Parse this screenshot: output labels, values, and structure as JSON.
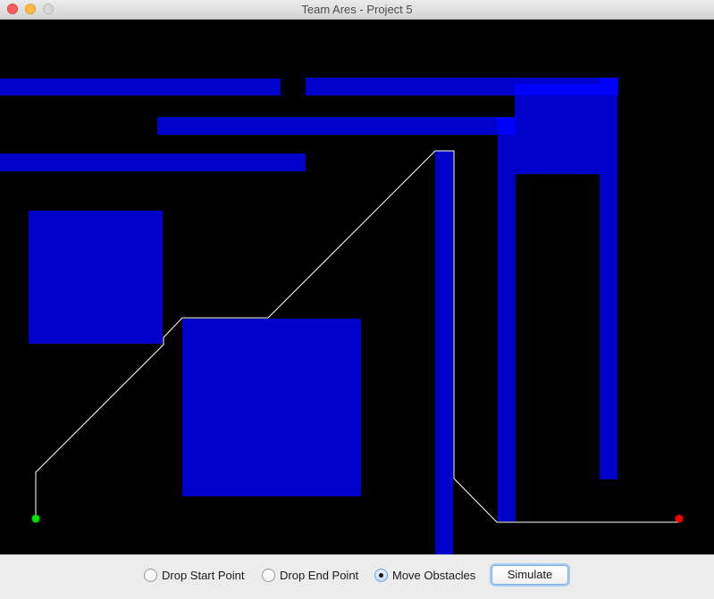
{
  "window": {
    "title": "Team Ares - Project 5"
  },
  "canvas": {
    "background": "#000000",
    "obstacle_color": "#0000cc",
    "obstacle_highlight_color": "#0000ff",
    "path_color": "#ffffff",
    "start_point_color": "#00e000",
    "end_point_color": "#ff0000"
  },
  "controls": {
    "options": [
      {
        "label": "Drop Start Point",
        "selected": false
      },
      {
        "label": "Drop End Point",
        "selected": false
      },
      {
        "label": "Move Obstacles",
        "selected": true
      }
    ],
    "simulate_label": "Simulate"
  }
}
